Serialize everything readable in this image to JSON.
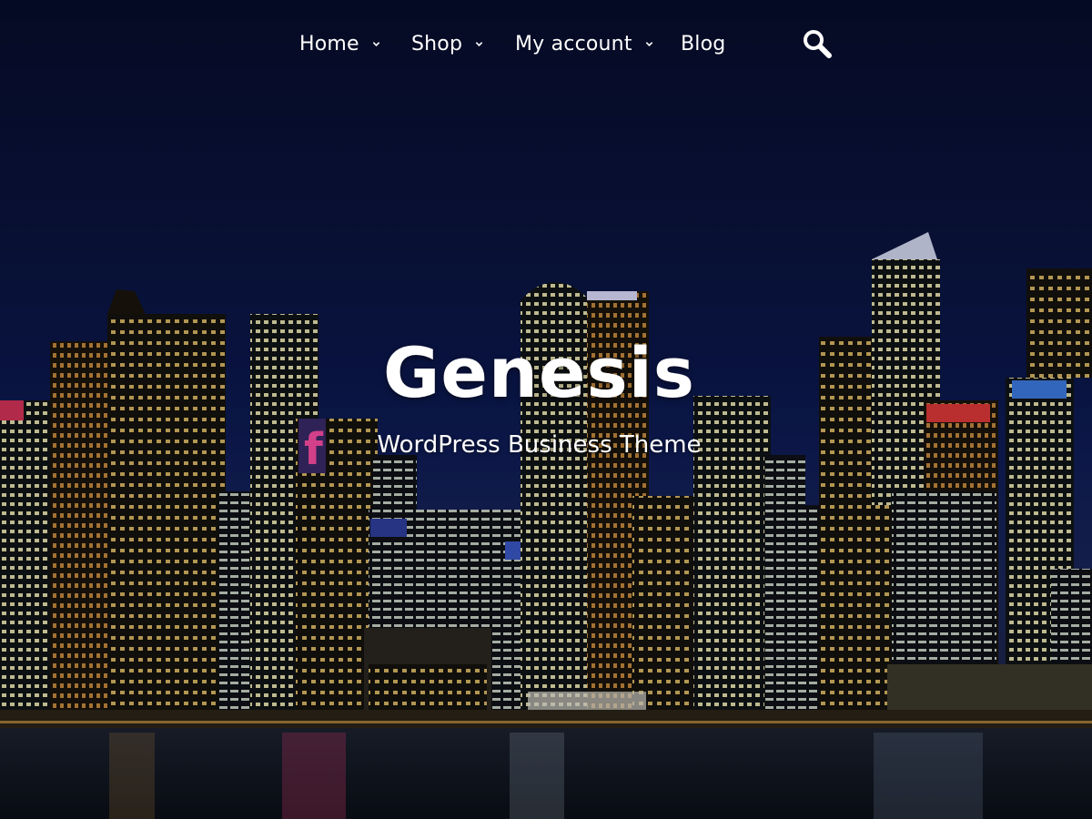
{
  "nav": {
    "items": [
      {
        "label": "Home",
        "has_dropdown": true
      },
      {
        "label": "Shop",
        "has_dropdown": true
      },
      {
        "label": "My account",
        "has_dropdown": true
      },
      {
        "label": "Blog",
        "has_dropdown": false
      }
    ],
    "search_icon": "search-icon"
  },
  "hero": {
    "title": "Genesis",
    "subtitle": "WordPress Business Theme",
    "background": "night-city-skyline-photo"
  },
  "colors": {
    "text": "#ffffff",
    "sky": "#0a1440"
  }
}
